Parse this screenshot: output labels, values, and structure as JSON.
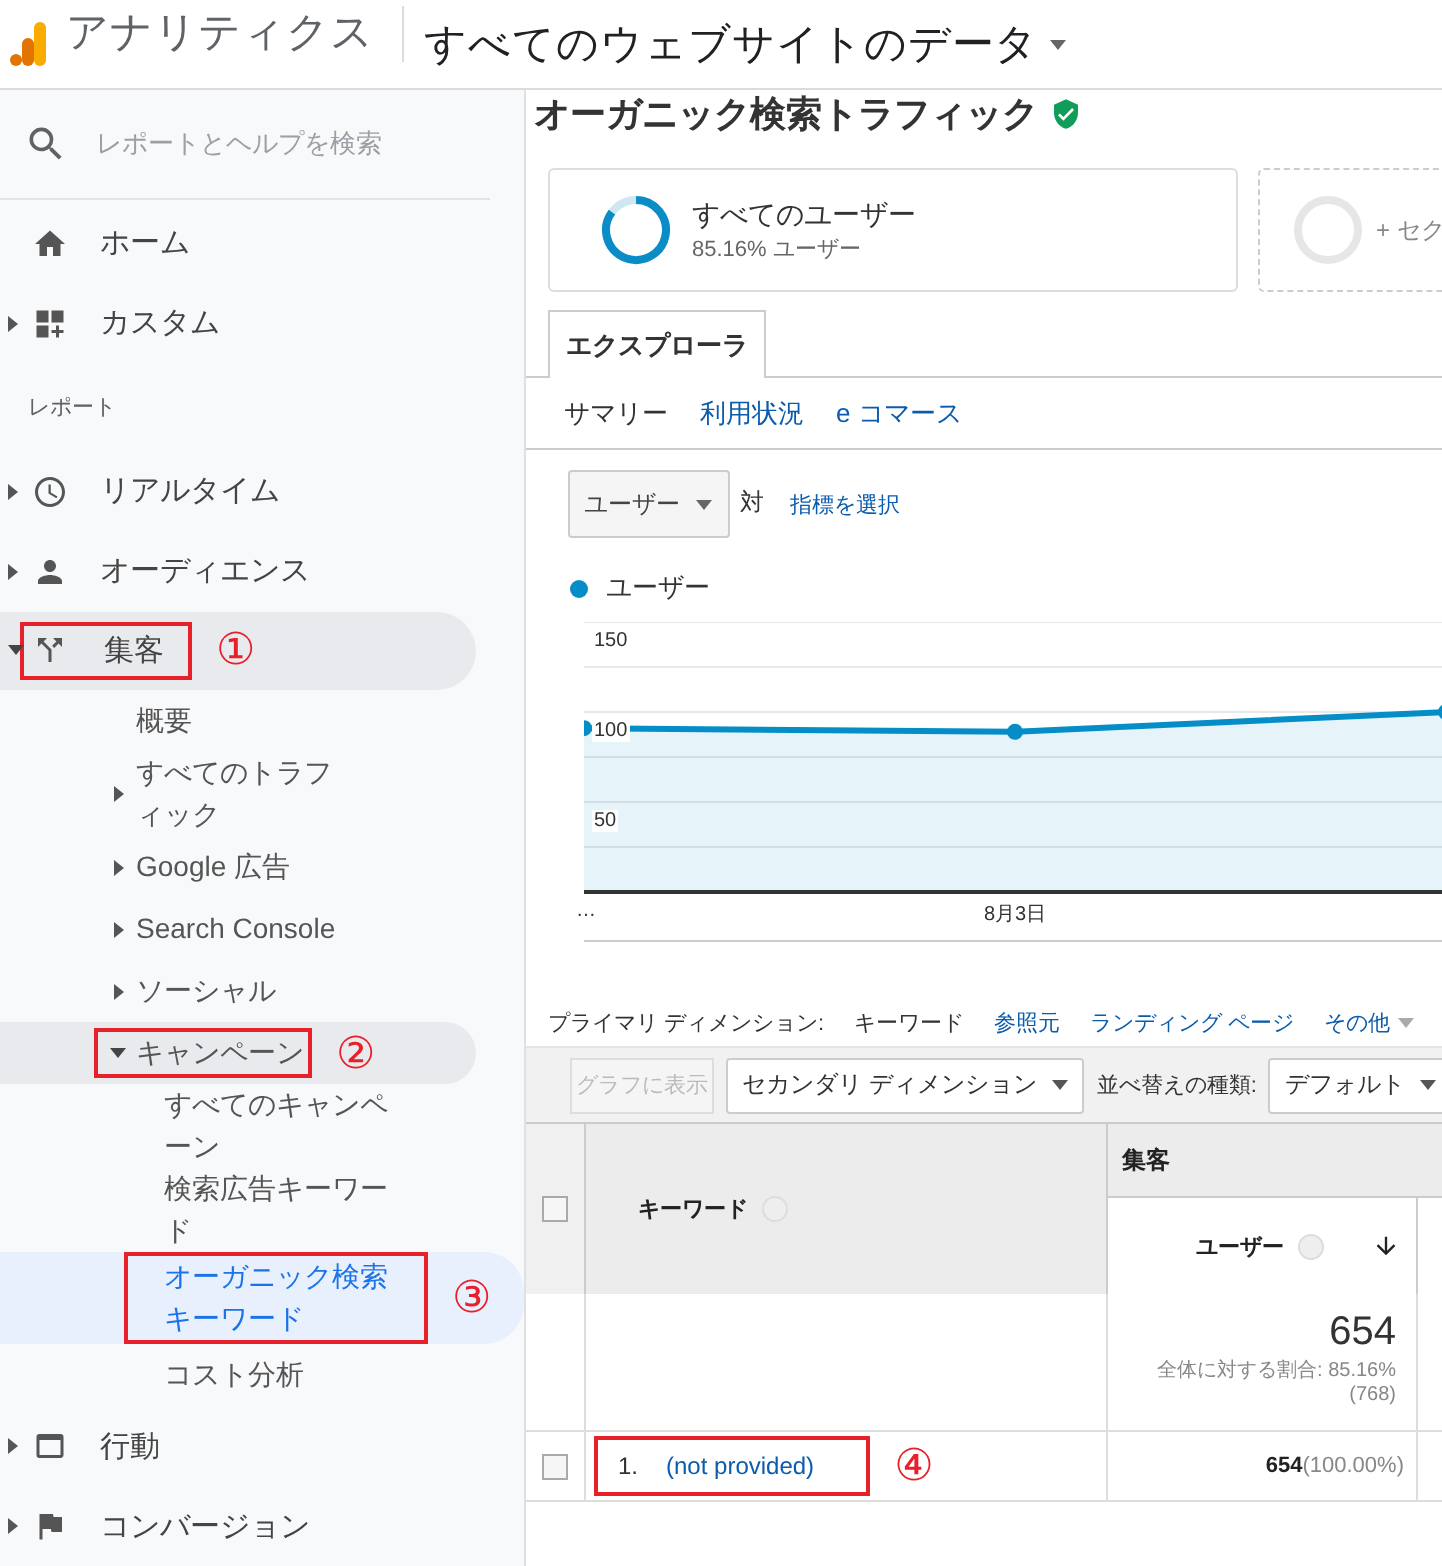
{
  "header": {
    "product": "アナリティクス",
    "property": "すべてのウェブサイトのデータ"
  },
  "sidebar": {
    "search": {
      "placeholder": "レポートとヘルプを検索"
    },
    "top_items": [
      {
        "label": "ホーム",
        "kind": "link",
        "selected": false
      },
      {
        "label": "カスタム",
        "kind": "group",
        "expanded": false,
        "selected": false
      }
    ],
    "section_label": "レポート",
    "items": [
      {
        "label": "リアルタイム",
        "kind": "group",
        "expanded": false,
        "selected": false
      },
      {
        "label": "オーディエンス",
        "kind": "group",
        "expanded": false,
        "selected": false
      },
      {
        "label": "集客",
        "kind": "group",
        "expanded": true,
        "selected": false,
        "callout": "①",
        "children": [
          {
            "label": "概要",
            "kind": "link",
            "selected": false
          },
          {
            "label": "すべてのトラフィック",
            "kind": "group",
            "expanded": false,
            "selected": false
          },
          {
            "label": "Google 広告",
            "kind": "group",
            "expanded": false,
            "selected": false
          },
          {
            "label": "Search Console",
            "kind": "group",
            "expanded": false,
            "selected": false
          },
          {
            "label": "ソーシャル",
            "kind": "group",
            "expanded": false,
            "selected": false
          },
          {
            "label": "キャンペーン",
            "kind": "group",
            "expanded": true,
            "selected": false,
            "callout": "②",
            "children": [
              {
                "label": "すべてのキャンペーン",
                "kind": "link",
                "selected": false
              },
              {
                "label": "検索広告キーワード",
                "kind": "link",
                "selected": false
              },
              {
                "label": "オーガニック検索キーワード",
                "kind": "link",
                "selected": true,
                "callout": "③"
              },
              {
                "label": "コスト分析",
                "kind": "link",
                "selected": false
              }
            ]
          }
        ]
      },
      {
        "label": "行動",
        "kind": "group",
        "expanded": false,
        "selected": false
      },
      {
        "label": "コンバージョン",
        "kind": "group",
        "expanded": false,
        "selected": false
      }
    ]
  },
  "page": {
    "title": "オーガニック検索トラフィック",
    "verified": true,
    "segments": [
      {
        "name": "すべてのユーザー",
        "detail": "85.16% ユーザー",
        "level": 0.8516,
        "kind": "segment"
      },
      {
        "name": "+ セク",
        "kind": "add"
      }
    ],
    "tabs": [
      {
        "label": "エクスプローラ",
        "selected": true
      }
    ],
    "subtabs": [
      {
        "label": "サマリー",
        "selected": true
      },
      {
        "label": "利用状況",
        "selected": false
      },
      {
        "label": "e コマース",
        "selected": false
      }
    ],
    "metric_select": "ユーザー",
    "versus": "対",
    "choose_metric": "指標を選択",
    "chart_data": {
      "type": "area",
      "ylim": [
        0,
        150
      ],
      "yticks": [
        {
          "value": 50,
          "label": "50"
        },
        {
          "value": 100,
          "label": "100"
        },
        {
          "value": 150,
          "label": "150"
        }
      ],
      "series": [
        {
          "name": "ユーザー",
          "color": "#058dc7",
          "values": [
            91,
            89,
            100
          ]
        }
      ],
      "annotations": [
        "8月3日"
      ]
    },
    "chart_overflow_label": "…",
    "primary_dimension": {
      "label": "プライマリ ディメンション:",
      "options": [
        {
          "label": "キーワード",
          "selected": true
        },
        {
          "label": "参照元",
          "selected": false
        },
        {
          "label": "ランディング ページ",
          "selected": false
        },
        {
          "label": "その他",
          "selected": false,
          "kind": "menu"
        }
      ]
    },
    "toolbar": {
      "plot_button": {
        "label": "グラフに表示",
        "disabled": true
      },
      "secondary_dimension": "セカンダリ ディメンション",
      "sort_label": "並べ替えの種類:",
      "sort_select": "デフォルト"
    },
    "table": {
      "select_all_checked": false,
      "group_header": "集客",
      "columns": [
        {
          "label": "キーワード"
        },
        {
          "label": "ユーザー",
          "sorted": true
        }
      ],
      "totals": {
        "value": "654",
        "share": "全体に対する割合: 85.16%",
        "total": "(768)"
      },
      "rows": [
        {
          "index": "1.",
          "keyword": "(not provided)",
          "users": "**654**(100.00%)",
          "checked": false,
          "callout": "④"
        }
      ]
    }
  }
}
